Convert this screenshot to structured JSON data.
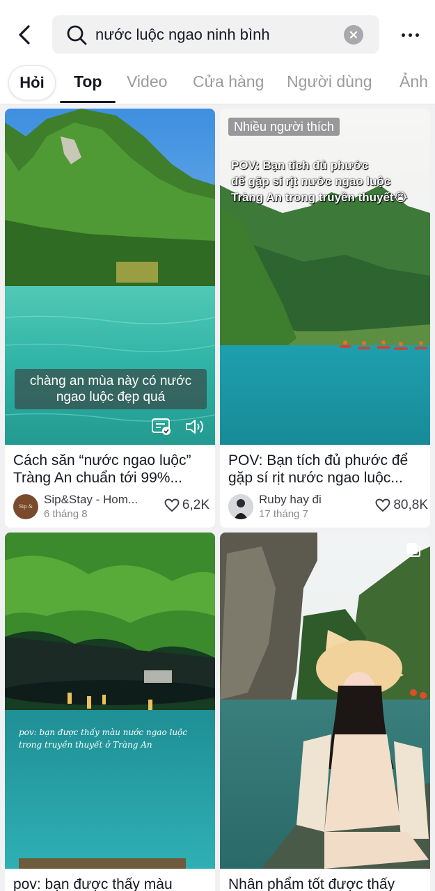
{
  "search": {
    "value": "nước luộc ngao ninh bình"
  },
  "icons": {
    "back": "chevron-left-icon",
    "search": "search-icon",
    "clear": "clear-icon",
    "more": "more-horizontal-icon"
  },
  "tabs": {
    "ask": "Hỏi",
    "items": [
      "Top",
      "Video",
      "Cửa hàng",
      "Người dùng",
      "Ảnh"
    ],
    "active": "Top"
  },
  "cards": [
    {
      "overlay_line1": "chàng an mùa này có nước",
      "overlay_line2": "ngao luộc đẹp quá",
      "caption_line1": "Cách săn “nước ngao luộc”",
      "caption_line2": "Tràng An chuẩn tới 99%...",
      "author": "Sip&Stay - Hom...",
      "date": "6 tháng 8",
      "likes": "6,2K",
      "avatar_text": "Sip & Stay"
    },
    {
      "badge": "Nhiều người thích",
      "pov_line1": "POV: Bạn tích đủ phước",
      "pov_line2": "để gặp sí rịt nước ngao luộc",
      "pov_line3": "Tràng An trong truyền thuyết😭",
      "caption_line1": "POV: Bạn tích đủ phước để",
      "caption_line2": "gặp sí rịt nước ngao luộc...",
      "author": "Ruby hay đi",
      "date": "17 tháng 7",
      "likes": "80,8K"
    },
    {
      "script_line1": "pov: bạn được thấy màu nước ngao luộc",
      "script_line2": "trong truyền thuyết ở Tràng An",
      "caption_line1": "pov: bạn được thấy màu"
    },
    {
      "caption_line1": "Nhân phẩm tốt được thấy"
    }
  ]
}
